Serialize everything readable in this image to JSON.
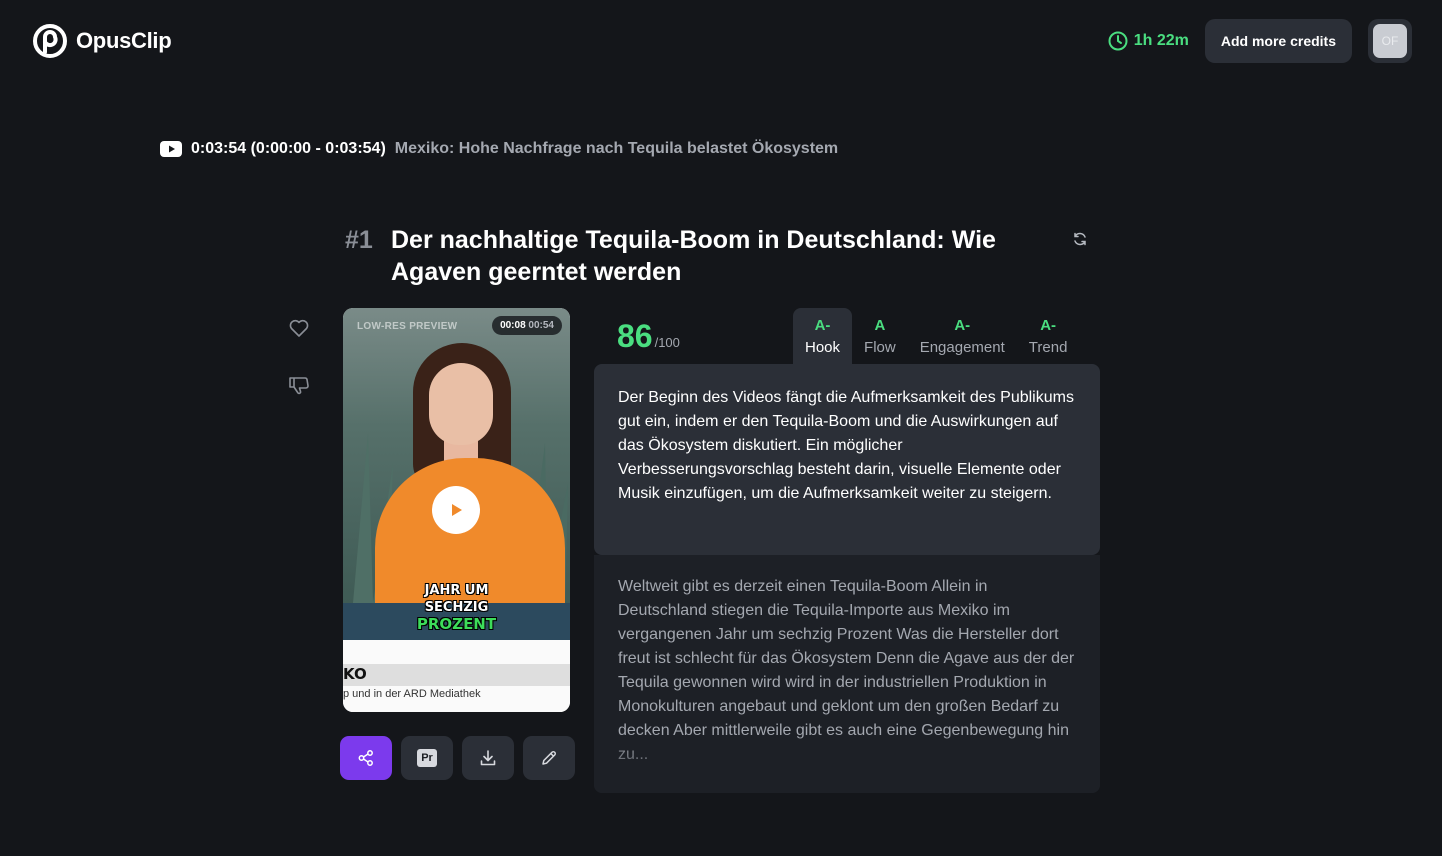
{
  "header": {
    "logo_text": "OpusClip",
    "time_remaining": "1h 22m",
    "add_credits_label": "Add more credits",
    "avatar_initials": "OF"
  },
  "source": {
    "time": "0:03:54 (0:00:00 - 0:03:54)",
    "title": "Mexiko: Hohe Nachfrage nach Tequila belastet Ökosystem"
  },
  "clip": {
    "rank": "#1",
    "title": "Der nachhaltige Tequila-Boom in Deutschland: Wie Agaven geerntet werden",
    "video": {
      "preview_label": "LOW-RES PREVIEW",
      "current_time": "00:08",
      "total_time": "00:54",
      "caption_line1": "JAHR UM",
      "caption_line2": "SECHZIG",
      "caption_line3": "PROZENT",
      "ticker_line1": "KO",
      "ticker_line2": "p und in der ARD Mediathek"
    },
    "score": "86",
    "score_max": "/100",
    "tabs": [
      {
        "grade": "A-",
        "name": "Hook",
        "active": true
      },
      {
        "grade": "A",
        "name": "Flow",
        "active": false
      },
      {
        "grade": "A-",
        "name": "Engagement",
        "active": false
      },
      {
        "grade": "A-",
        "name": "Trend",
        "active": false
      }
    ],
    "analysis": "Der Beginn des Videos fängt die Aufmerksamkeit des Publikums gut ein, indem er den Tequila-Boom und die Auswirkungen auf das Ökosystem diskutiert. Ein möglicher Verbesserungsvorschlag besteht darin, visuelle Elemente oder Musik einzufügen, um die Aufmerksamkeit weiter zu steigern.",
    "transcript": "Weltweit gibt es derzeit einen Tequila-Boom Allein in Deutschland stiegen die Tequila-Importe aus Mexiko im vergangenen Jahr um sechzig Prozent Was die Hersteller dort freut ist schlecht für das Ökosystem Denn die Agave aus der der Tequila gewonnen wird wird in der industriellen Produktion in Monokulturen angebaut und geklont um den großen Bedarf zu decken Aber mittlerweile gibt es auch eine Gegenbewegung hin zu..."
  },
  "colors": {
    "background": "#14161a",
    "panel": "#2b2f37",
    "accent_green": "#4ade80",
    "accent_purple": "#7c3aed"
  },
  "icons": [
    "opusclip-logo-icon",
    "clock-icon",
    "youtube-icon",
    "refresh-icon",
    "heart-icon",
    "thumbs-down-icon",
    "play-icon",
    "share-icon",
    "premiere-pro-icon",
    "download-icon",
    "edit-pencil-icon"
  ]
}
